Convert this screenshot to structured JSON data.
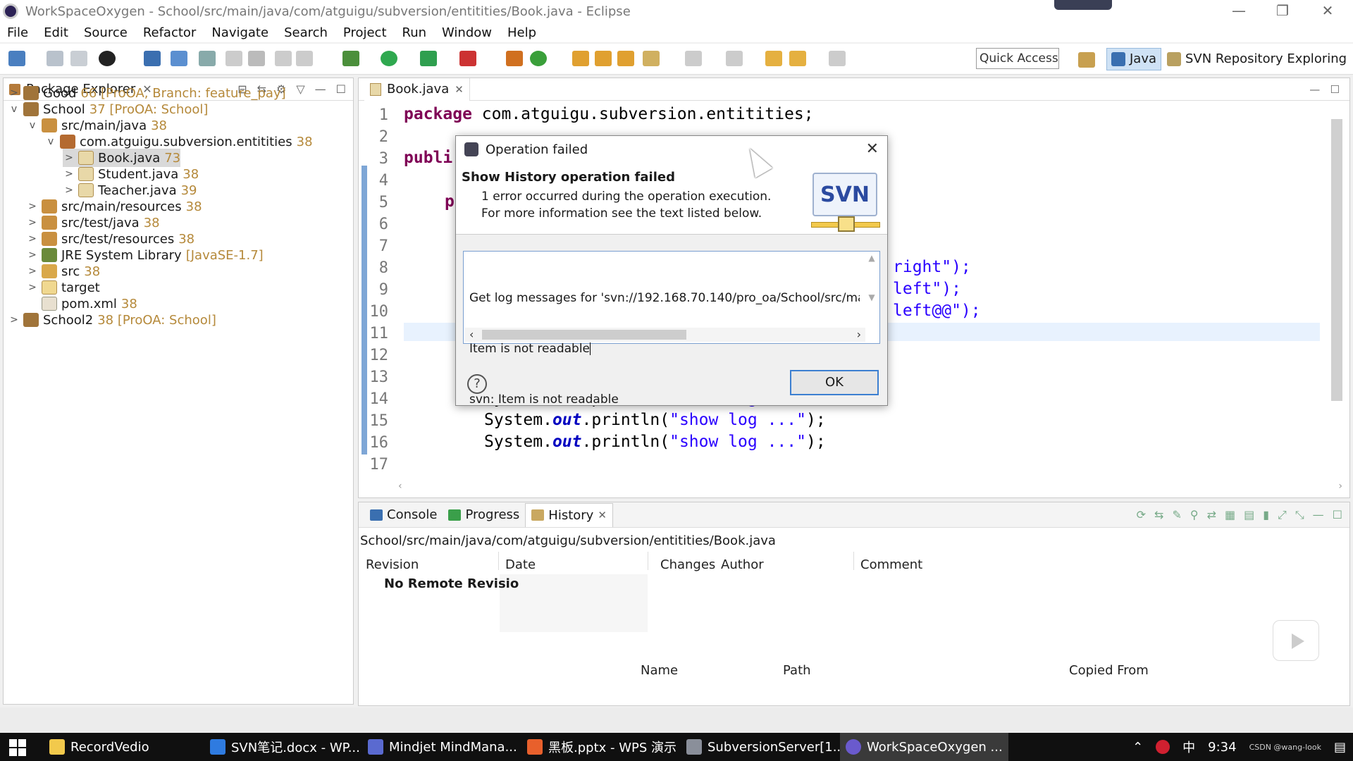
{
  "window": {
    "title": "WorkSpaceOxygen - School/src/main/java/com/atguigu/subversion/entitities/Book.java - Eclipse",
    "minimize": "—",
    "maximize": "❐",
    "close": "✕"
  },
  "menu": [
    "File",
    "Edit",
    "Source",
    "Refactor",
    "Navigate",
    "Search",
    "Project",
    "Run",
    "Window",
    "Help"
  ],
  "toolbar": {
    "quick_access": "Quick Access",
    "perspectives": [
      "Java",
      "SVN Repository Exploring"
    ]
  },
  "package_explorer": {
    "title": "Package Explorer",
    "items": [
      {
        "twisty": ">",
        "label": "Good",
        "deco": "66 [ProOA, Branch: feature_pay]"
      },
      {
        "twisty": "v",
        "label": "School",
        "deco": "37 [ProOA: School]"
      },
      {
        "twisty": "v",
        "label": "src/main/java",
        "deco": "38"
      },
      {
        "twisty": "v",
        "label": "com.atguigu.subversion.entitities",
        "deco": "38"
      },
      {
        "twisty": ">",
        "label": "Book.java",
        "deco": "73"
      },
      {
        "twisty": ">",
        "label": "Student.java",
        "deco": "38"
      },
      {
        "twisty": ">",
        "label": "Teacher.java",
        "deco": "39"
      },
      {
        "twisty": ">",
        "label": "src/main/resources",
        "deco": "38"
      },
      {
        "twisty": ">",
        "label": "src/test/java",
        "deco": "38"
      },
      {
        "twisty": ">",
        "label": "src/test/resources",
        "deco": "38"
      },
      {
        "twisty": ">",
        "label": "JRE System Library",
        "deco": "[JavaSE-1.7]"
      },
      {
        "twisty": ">",
        "label": "src",
        "deco": "38"
      },
      {
        "twisty": ">",
        "label": "target",
        "deco": ""
      },
      {
        "twisty": "",
        "label": "pom.xml",
        "deco": "38"
      },
      {
        "twisty": ">",
        "label": "School2",
        "deco": "38 [ProOA: School]"
      }
    ]
  },
  "editor": {
    "tab": "Book.java",
    "line_numbers": [
      "1",
      "2",
      "3",
      "4",
      "5",
      "6",
      "7",
      "8",
      "9",
      "10",
      "11",
      "12",
      "13",
      "14",
      "15",
      "16",
      "17"
    ],
    "line1_kw": "package",
    "line1_rest": " com.atguigu.subversion.entitities;",
    "line3_partial": "publi",
    "line5_partial": "p",
    "line8_tail": "right\");",
    "line9_tail": "left\");",
    "line10_tail": "left@@\");",
    "println_prefix": "System.",
    "println_field": "out",
    "println_mid": ".println(",
    "println_str": "\"show log ...\"",
    "println_end": ");"
  },
  "bottom": {
    "tabs": [
      "Console",
      "Progress",
      "History"
    ],
    "history_path": "School/src/main/java/com/atguigu/subversion/entitities/Book.java",
    "columns": [
      "Revision",
      "Date",
      "Changes",
      "Author",
      "Comment"
    ],
    "no_remote": "No Remote Revisio",
    "columns2": [
      "Name",
      "Path",
      "Copied From"
    ]
  },
  "dialog": {
    "title": "Operation failed",
    "heading": "Show History operation failed",
    "message": "1 error occurred during the operation execution. For more information see the text listed below.",
    "logo_text": "SVN",
    "details": [
      "Get log messages for 'svn://192.168.70.140/pro_oa/School/src/mair",
      "Item is not readable",
      "svn: Item is not readable"
    ],
    "help": "?",
    "ok": "OK"
  },
  "taskbar": {
    "items": [
      "RecordVedio",
      "SVN笔记.docx - WP...",
      "Mindjet MindMana...",
      "黑板.pptx - WPS 演示",
      "SubversionServer[1...",
      "WorkSpaceOxygen ..."
    ],
    "ime": "中",
    "clock": "9:34",
    "watermark": "CSDN @wang-look"
  },
  "colors": {
    "keyword": "#7f0055",
    "string": "#2a00ff",
    "field": "#0000c0",
    "decoration": "#b5893a",
    "selection": "#d9d9d9"
  }
}
